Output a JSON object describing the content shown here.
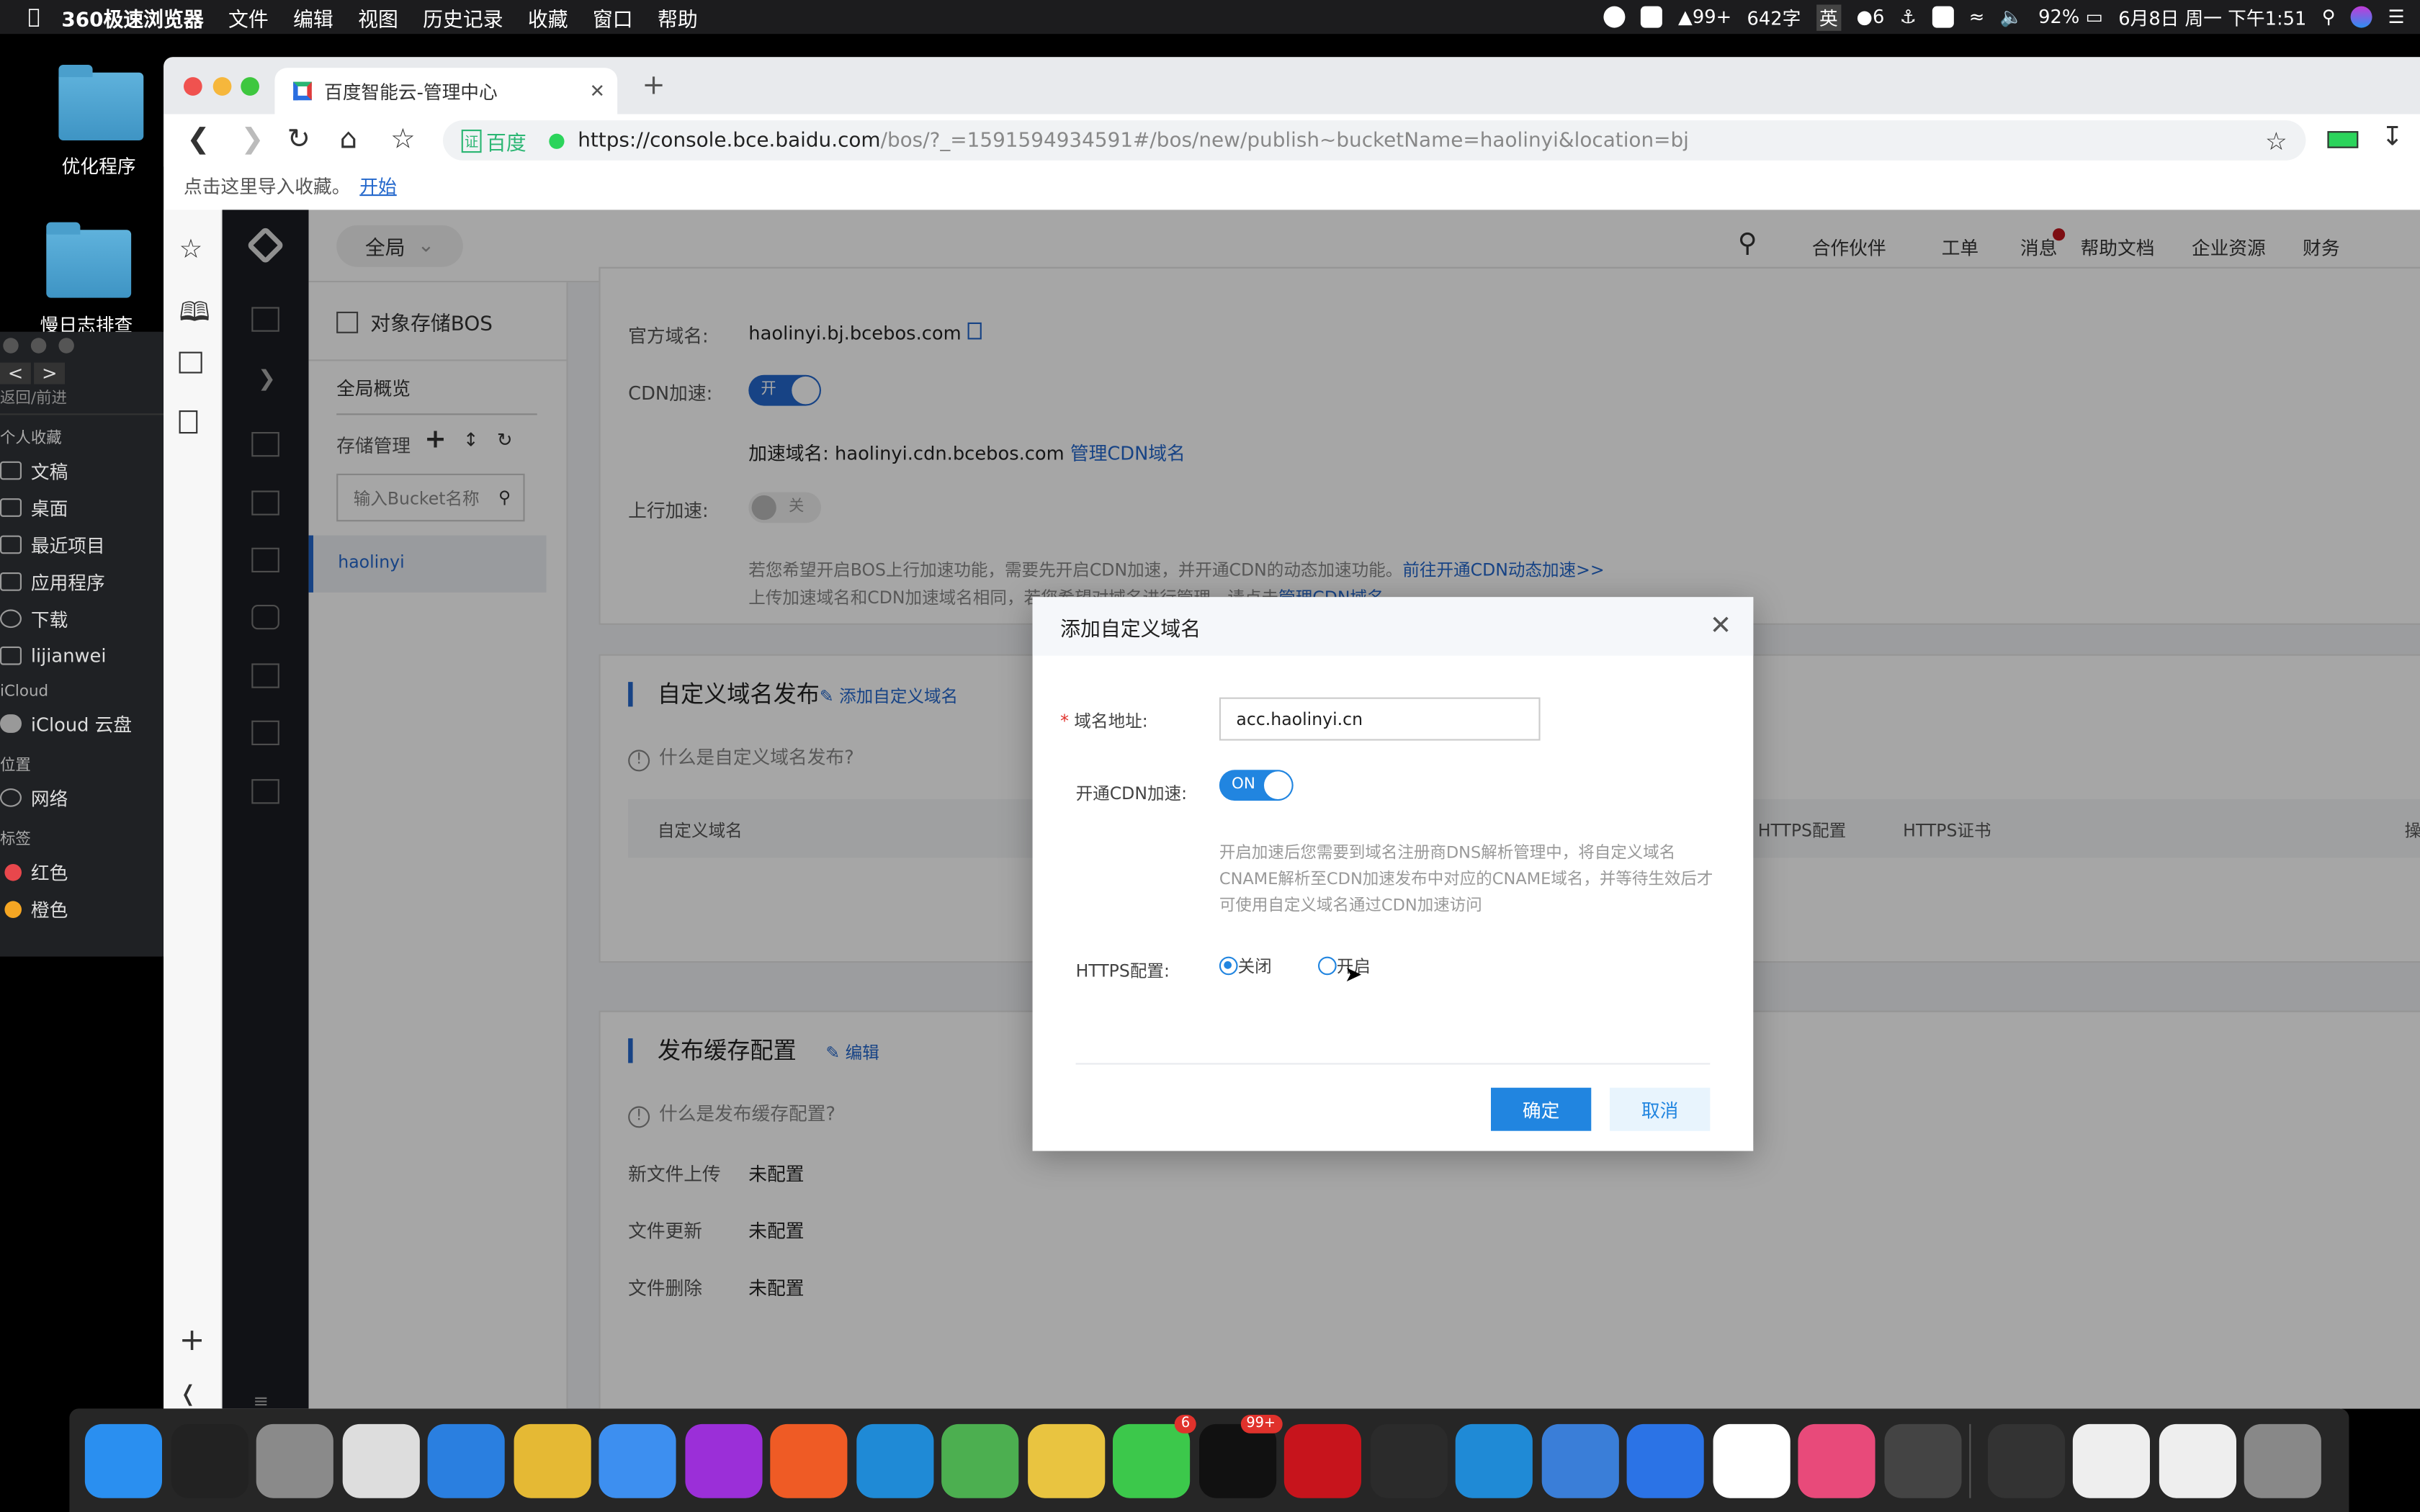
{
  "menubar": {
    "app": "360极速浏览器",
    "items": [
      "文件",
      "编辑",
      "视图",
      "历史记录",
      "收藏",
      "窗口",
      "帮助"
    ],
    "status": {
      "qq_count": "99+",
      "word_count": "642字",
      "input_method": "英",
      "wechat_count": "6",
      "battery": "92%",
      "datetime": "6月8日 周一 下午1:51"
    }
  },
  "desktop": {
    "icons": [
      {
        "label": "优化程序",
        "icon": "folder-icon"
      },
      {
        "label": "慢日志排查",
        "icon": "folder-icon"
      }
    ]
  },
  "finder": {
    "nav_label": "返回/前进",
    "sections": [
      {
        "title": "个人收藏",
        "items": [
          "文稿",
          "桌面",
          "最近项目",
          "应用程序",
          "下载",
          "lijianwei"
        ]
      },
      {
        "title": "iCloud",
        "items": [
          "iCloud 云盘"
        ]
      },
      {
        "title": "位置",
        "items": [
          "网络"
        ]
      },
      {
        "title": "标签",
        "items": [
          "红色",
          "橙色"
        ]
      }
    ],
    "tag_colors": [
      "#e8474c",
      "#f5a623"
    ]
  },
  "browser": {
    "tab_title": "百度智能云-管理中心",
    "cert_label": "百度",
    "url": "https://console.bce.baidu.com/bos/?_=1591594934591#/bos/new/publish~bucketName=haolinyi&location=bj",
    "url_host": "https://console.bce.baidu.com",
    "url_rest": "/bos/?_=1591594934591#/bos/new/publish~bucketName=haolinyi&location=bj",
    "bookmark_hint": "点击这里导入收藏。",
    "bookmark_link": "开始"
  },
  "console": {
    "scope": "全局",
    "header_nav": [
      "合作伙伴",
      "工单",
      "消息",
      "帮助文档",
      "企业资源",
      "财务"
    ],
    "service_title": "对象存储BOS",
    "overview": "全局概览",
    "storage_mgmt": "存储管理",
    "bucket_search_placeholder": "输入Bucket名称",
    "buckets": [
      "haolinyi"
    ]
  },
  "content": {
    "official_domain_label": "官方域名:",
    "official_domain": "haolinyi.bj.bcebos.com",
    "cdn_label": "CDN加速:",
    "cdn_toggle": "开",
    "cdn_enabled": true,
    "acc_domain_label": "加速域名:",
    "acc_domain": "haolinyi.cdn.bcebos.com",
    "manage_cdn": "管理CDN域名",
    "upload_acc_label": "上行加速:",
    "upload_acc_toggle": "关",
    "upload_acc_enabled": false,
    "upload_hint1": "若您希望开启BOS上行加速功能，需要先开启CDN加速，并开通CDN的动态加速功能。",
    "upload_hint1_link": "前往开通CDN动态加速>>",
    "upload_hint2": "上传加速域名和CDN加速域名相同，若您希望对域名进行管理，请点击",
    "upload_hint2_link": "管理CDN域名",
    "custom": {
      "title": "自定义域名发布",
      "add_link": "添加自定义域名",
      "hint": "什么是自定义域名发布?",
      "columns": [
        "自定义域名",
        "HTTPS配置",
        "HTTPS证书",
        "操作"
      ]
    },
    "cache": {
      "title": "发布缓存配置",
      "edit_link": "编辑",
      "hint": "什么是发布缓存配置?",
      "rows": [
        {
          "label": "新文件上传",
          "value": "未配置"
        },
        {
          "label": "文件更新",
          "value": "未配置"
        },
        {
          "label": "文件删除",
          "value": "未配置"
        }
      ]
    }
  },
  "dialog": {
    "title": "添加自定义域名",
    "domain_label": "域名地址:",
    "domain_value": "acc.haolinyi.cn",
    "cdn_label": "开通CDN加速:",
    "cdn_toggle": "ON",
    "cdn_enabled": true,
    "note": "开启加速后您需要到域名注册商DNS解析管理中，将自定义域名CNAME解析至CDN加速发布中对应的CNAME域名，并等待生效后才可使用自定义域名通过CDN加速访问",
    "https_label": "HTTPS配置:",
    "https_options": [
      "关闭",
      "开启"
    ],
    "https_selected": "关闭",
    "ok": "确定",
    "cancel": "取消"
  },
  "dock": {
    "apps": [
      {
        "icon": "finder-icon",
        "color": "#2a8ff0"
      },
      {
        "icon": "terminal-icon",
        "color": "#222"
      },
      {
        "icon": "launchpad-icon",
        "color": "#8a8a8a"
      },
      {
        "icon": "milk-jug-icon",
        "color": "#ddd"
      },
      {
        "icon": "paw-arrow-icon",
        "color": "#2a7fe0"
      },
      {
        "icon": "transmit-truck-icon",
        "color": "#e5b934"
      },
      {
        "icon": "pencil-app-icon",
        "color": "#3d8ff0"
      },
      {
        "icon": "phpstorm-icon",
        "color": "#9b2fd8"
      },
      {
        "icon": "postman-icon",
        "color": "#ef5b25"
      },
      {
        "icon": "vscode-icon",
        "color": "#1f8ad6"
      },
      {
        "icon": "chrome-icon",
        "color": "#4caf50"
      },
      {
        "icon": "sequel-icon",
        "color": "#e9c440"
      },
      {
        "icon": "wechat-icon",
        "color": "#3cc84b",
        "badge": "6"
      },
      {
        "icon": "qq-icon",
        "color": "#111",
        "badge": "99+"
      },
      {
        "icon": "netease-music-icon",
        "color": "#c7141c"
      },
      {
        "icon": "code-editor-icon",
        "color": "#2b2b2b"
      },
      {
        "icon": "vscode-insiders-icon",
        "color": "#1f8ad6"
      },
      {
        "icon": "xcode-instruments-icon",
        "color": "#3a7ed8"
      },
      {
        "icon": "wps-icon",
        "color": "#2b73e6"
      },
      {
        "icon": "infuse-icon",
        "color": "#fff"
      },
      {
        "icon": "colorful-app-icon",
        "color": "#e84a7a"
      },
      {
        "icon": "quicktime-icon",
        "color": "#444"
      },
      {
        "icon": "window-thumb-icon",
        "color": "#333"
      },
      {
        "icon": "window-thumb-icon",
        "color": "#eee"
      },
      {
        "icon": "window-thumb-icon",
        "color": "#eee"
      },
      {
        "icon": "trash-icon",
        "color": "#888"
      }
    ]
  }
}
